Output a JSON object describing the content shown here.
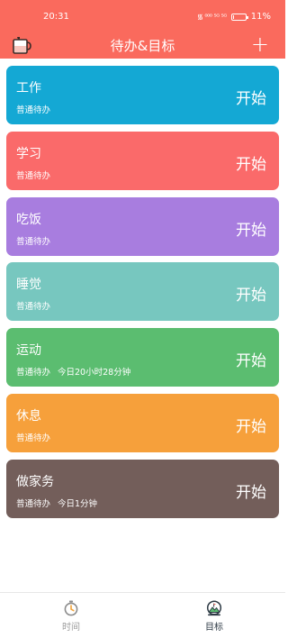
{
  "status_bar": {
    "time": "20:31",
    "signal_text": "᯾ ⁰⁰⁰ ⁵ᴳ ⁵ᴳ",
    "battery": "11%",
    "battery_level": 0.11
  },
  "header": {
    "title": "待办&目标",
    "plus_label": "+"
  },
  "tasks": [
    {
      "name": "工作",
      "meta": "普通待办",
      "extra": "",
      "action": "开始",
      "color": "#14a8d4"
    },
    {
      "name": "学习",
      "meta": "普通待办",
      "extra": "",
      "action": "开始",
      "color": "#fa6a6a"
    },
    {
      "name": "吃饭",
      "meta": "普通待办",
      "extra": "",
      "action": "开始",
      "color": "#a87ddf"
    },
    {
      "name": "睡觉",
      "meta": "普通待办",
      "extra": "",
      "action": "开始",
      "color": "#77c7bf"
    },
    {
      "name": "运动",
      "meta": "普通待办",
      "extra": "今日20小时28分钟",
      "action": "开始",
      "color": "#5bbd70"
    },
    {
      "name": "休息",
      "meta": "普通待办",
      "extra": "",
      "action": "开始",
      "color": "#f6a03b"
    },
    {
      "name": "做家务",
      "meta": "普通待办",
      "extra": "今日1分钟",
      "action": "开始",
      "color": "#735e5a"
    }
  ],
  "bottom_nav": [
    {
      "label": "时间",
      "icon": "stopwatch-icon",
      "active": false
    },
    {
      "label": "目标",
      "icon": "goal-mountain-icon",
      "active": true
    }
  ],
  "colors": {
    "primary": "#fa6a5d",
    "nav_inactive": "#9b9b9b",
    "nav_active": "#2e3a45"
  }
}
